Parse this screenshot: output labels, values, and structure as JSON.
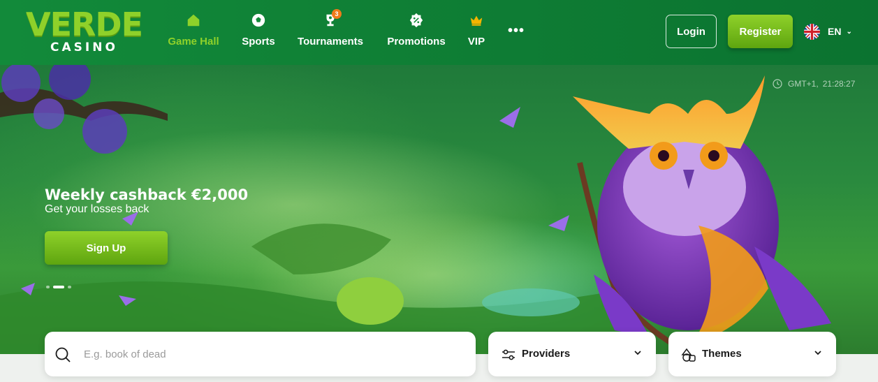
{
  "brand": {
    "logo_main": "VERDE",
    "logo_sub": "CASINO"
  },
  "nav": {
    "items": [
      {
        "label": "Game Hall",
        "icon": "home-icon",
        "active": true
      },
      {
        "label": "Sports",
        "icon": "soccer-ball-icon"
      },
      {
        "label": "Tournaments",
        "icon": "trophy-icon",
        "badge": "3"
      },
      {
        "label": "Promotions",
        "icon": "percent-badge-icon"
      },
      {
        "label": "VIP",
        "icon": "crown-icon"
      }
    ],
    "more_label": "•••"
  },
  "header": {
    "login_label": "Login",
    "register_label": "Register",
    "language": "EN",
    "language_flag": "uk-flag-icon"
  },
  "hero": {
    "timezone": "GMT+1,",
    "time": "21:28:27",
    "title": "Weekly cashback €2,000",
    "subtitle": "Get your losses back",
    "cta_label": "Sign Up",
    "slides": 3,
    "active_slide": 2
  },
  "filters": {
    "search_placeholder": "E.g. book of dead",
    "providers_label": "Providers",
    "themes_label": "Themes"
  },
  "colors": {
    "header_green": "#128a3a",
    "accent_lime": "#8fd12a",
    "badge_orange": "#f07a1a"
  }
}
